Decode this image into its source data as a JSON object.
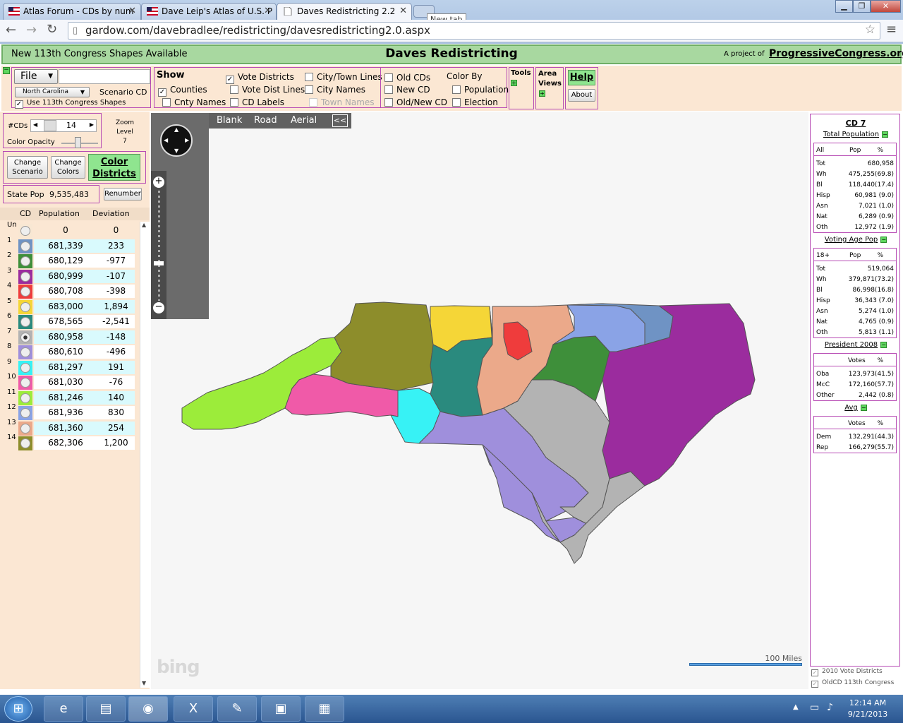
{
  "browser": {
    "tabs": [
      {
        "label": "Atlas Forum - CDs by num"
      },
      {
        "label": "Dave Leip's Atlas of U.S. P"
      },
      {
        "label": "Daves Redistricting 2.2"
      }
    ],
    "new_tab_tooltip": "New tab",
    "url": "gardow.com/davebradlee/redistricting/davesredistricting2.0.aspx"
  },
  "header": {
    "notice": "New 113th Congress Shapes Available",
    "title": "Daves Redistricting",
    "project_prefix": "A project of",
    "project_link": "ProgressiveCongress.org"
  },
  "file_panel": {
    "file_label": "File",
    "state": "North Carolina",
    "scenario": "Scenario CD",
    "use_113": "Use 113th Congress Shapes"
  },
  "show_panel": {
    "title": "Show",
    "counties": "Counties",
    "cnty_names": "Cnty Names",
    "vote_districts": "Vote Districts",
    "vote_dist_lines": "Vote Dist Lines",
    "cd_labels": "CD Labels",
    "city_town_lines": "City/Town Lines",
    "city_names": "City Names",
    "town_names": "Town Names",
    "old_cds": "Old CDs",
    "new_cd": "New CD",
    "old_new_cd": "Old/New CD",
    "color_by": "Color By",
    "population": "Population",
    "election": "Election"
  },
  "tools": {
    "tools": "Tools",
    "area": "Area",
    "views": "Views",
    "help": "Help",
    "about": "About"
  },
  "cd_controls": {
    "cds_label": "#CDs",
    "cds_value": "14",
    "zoom_label": "Zoom",
    "level_label": "Level",
    "zoom_value": "7",
    "opacity_label": "Color Opacity",
    "opacity_value": 0.45,
    "change_scenario_1": "Change",
    "change_scenario_2": "Scenario",
    "change_colors_1": "Change",
    "change_colors_2": "Colors",
    "color_districts_1": "Color",
    "color_districts_2": "Districts",
    "state_pop_label": "State Pop",
    "state_pop_value": "9,535,483",
    "renumber": "Renumber"
  },
  "cd_table": {
    "headers": [
      "CD",
      "Population",
      "Deviation"
    ],
    "rows": [
      {
        "cd": "Un",
        "pop": "0",
        "dev": "0",
        "color": "#f8e7d3"
      },
      {
        "cd": "1",
        "pop": "681,339",
        "dev": "233",
        "color": "#6f93c4"
      },
      {
        "cd": "2",
        "pop": "680,129",
        "dev": "-977",
        "color": "#3e8f3a"
      },
      {
        "cd": "3",
        "pop": "680,999",
        "dev": "-107",
        "color": "#9b2c9e"
      },
      {
        "cd": "4",
        "pop": "680,708",
        "dev": "-398",
        "color": "#ef3c3c"
      },
      {
        "cd": "5",
        "pop": "683,000",
        "dev": "1,894",
        "color": "#f5d637"
      },
      {
        "cd": "6",
        "pop": "678,565",
        "dev": "-2,541",
        "color": "#2a8a7e"
      },
      {
        "cd": "7",
        "pop": "680,958",
        "dev": "-148",
        "color": "#b3b3b3"
      },
      {
        "cd": "8",
        "pop": "680,610",
        "dev": "-496",
        "color": "#9f8fdc"
      },
      {
        "cd": "9",
        "pop": "681,297",
        "dev": "191",
        "color": "#37f2f5"
      },
      {
        "cd": "10",
        "pop": "681,030",
        "dev": "-76",
        "color": "#f05aa8"
      },
      {
        "cd": "11",
        "pop": "681,246",
        "dev": "140",
        "color": "#9cec3a"
      },
      {
        "cd": "12",
        "pop": "681,936",
        "dev": "830",
        "color": "#8aa3e6"
      },
      {
        "cd": "13",
        "pop": "681,360",
        "dev": "254",
        "color": "#eba98a"
      },
      {
        "cd": "14",
        "pop": "682,306",
        "dev": "1,200",
        "color": "#8d8d2b"
      }
    ]
  },
  "map": {
    "modes": [
      "Blank",
      "Road",
      "Aerial"
    ],
    "collapse": "<<",
    "scale": "100 Miles",
    "bing": "bing"
  },
  "right_panel": {
    "title": "CD 7",
    "total_pop_title": "Total Population",
    "total_pop_head": [
      "All",
      "Pop",
      "%"
    ],
    "total_pop": [
      {
        "k": "Tot",
        "v": "680,958"
      },
      {
        "k": "Wh",
        "v": "475,255(69.8)"
      },
      {
        "k": "Bl",
        "v": "118,440(17.4)"
      },
      {
        "k": "Hisp",
        "v": "60,981 (9.0)"
      },
      {
        "k": "Asn",
        "v": "7,021 (1.0)"
      },
      {
        "k": "Nat",
        "v": "6,289 (0.9)"
      },
      {
        "k": "Oth",
        "v": "12,972 (1.9)"
      }
    ],
    "vap_title": "Voting Age Pop",
    "vap_head": [
      "18+",
      "Pop",
      "%"
    ],
    "vap": [
      {
        "k": "Tot",
        "v": "519,064"
      },
      {
        "k": "Wh",
        "v": "379,871(73.2)"
      },
      {
        "k": "Bl",
        "v": "86,998(16.8)"
      },
      {
        "k": "Hisp",
        "v": "36,343 (7.0)"
      },
      {
        "k": "Asn",
        "v": "5,274 (1.0)"
      },
      {
        "k": "Nat",
        "v": "4,765 (0.9)"
      },
      {
        "k": "Oth",
        "v": "5,813 (1.1)"
      }
    ],
    "pres_title": "President 2008",
    "pres_head": [
      "Votes",
      "%"
    ],
    "pres": [
      {
        "k": "Oba",
        "v": "123,973(41.5)"
      },
      {
        "k": "McC",
        "v": "172,160(57.7)"
      },
      {
        "k": "Other",
        "v": "2,442 (0.8)"
      }
    ],
    "avg_title": "Avg",
    "avg_head": [
      "Votes",
      "%"
    ],
    "avg": [
      {
        "k": "Dem",
        "v": "132,291(44.3)"
      },
      {
        "k": "Rep",
        "v": "166,279(55.7)"
      }
    ],
    "footer_1": "2010 Vote Districts",
    "footer_2": "OldCD 113th Congress"
  },
  "taskbar": {
    "time": "12:14 AM",
    "date": "9/21/2013"
  }
}
